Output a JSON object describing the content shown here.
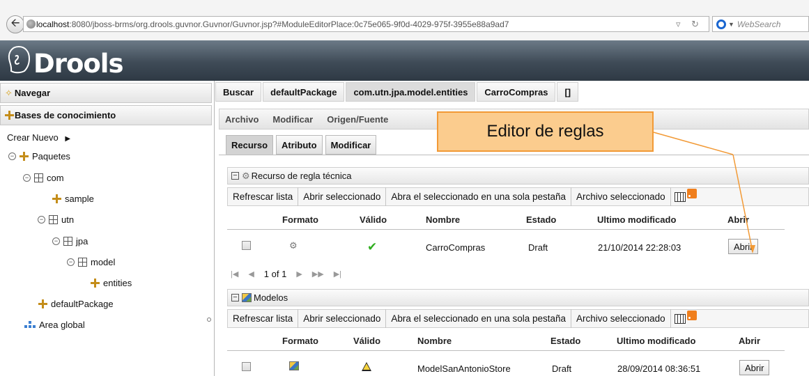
{
  "browser": {
    "url_host": "localhost",
    "url_rest": ":8080/jboss-brms/org.drools.guvnor.Guvnor/Guvnor.jsp?#ModuleEditorPlace:0c75e065-9f0d-4029-975f-3955e88a9ad7",
    "search_placeholder": "WebSearch"
  },
  "brand": {
    "name": "Drools"
  },
  "sidebar": {
    "nav_header": "Navegar",
    "kb_header": "Bases de conocimiento",
    "create_new": "Crear Nuevo",
    "tree": {
      "paquetes": "Paquetes",
      "com": "com",
      "sample": "sample",
      "utn": "utn",
      "jpa": "jpa",
      "model": "model",
      "entities": "entities",
      "default_package": "defaultPackage",
      "global_area": "Area global"
    }
  },
  "tabs": [
    "Buscar",
    "defaultPackage",
    "com.utn.jpa.model.entities",
    "CarroCompras",
    "[]"
  ],
  "menu": [
    "Archivo",
    "Modificar",
    "Origen/Fuente"
  ],
  "subtabs": [
    "Recurso",
    "Atributo",
    "Modificar"
  ],
  "callout": "Editor de reglas",
  "rules_section": {
    "title": "Recurso de regla técnica",
    "toolbar": [
      "Refrescar lista",
      "Abrir seleccionado",
      "Abra el seleccionado en una sola pestaña",
      "Archivo seleccionado"
    ],
    "columns": [
      "Formato",
      "Válido",
      "Nombre",
      "Estado",
      "Ultimo modificado",
      "Abrir"
    ],
    "rows": [
      {
        "name": "CarroCompras",
        "status": "Draft",
        "modified": "21/10/2014 22:28:03",
        "open_label": "Abrir"
      }
    ],
    "pager": "1 of 1"
  },
  "models_section": {
    "title": "Modelos",
    "toolbar": [
      "Refrescar lista",
      "Abrir seleccionado",
      "Abra el seleccionado en una sola pestaña",
      "Archivo seleccionado"
    ],
    "columns": [
      "Formato",
      "Válido",
      "Nombre",
      "Estado",
      "Ultimo modificado",
      "Abrir"
    ],
    "rows": [
      {
        "name": "ModelSanAntonioStore",
        "status": "Draft",
        "modified": "28/09/2014 08:36:51",
        "open_label": "Abrir"
      }
    ]
  },
  "colors": {
    "accent_orange": "#f29a36",
    "callout_fill": "#fbcc8e",
    "header_dark": "#3f4b57",
    "valid_green": "#2fae1f"
  }
}
